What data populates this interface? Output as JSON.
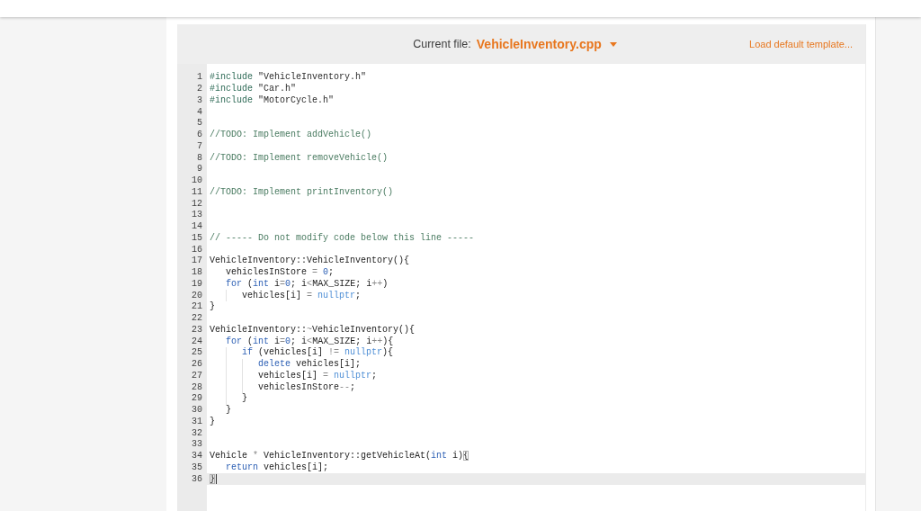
{
  "editor": {
    "current_file_label": "Current file:",
    "current_file": "VehicleInventory.cpp",
    "load_template_link": "Load default template...",
    "lines": [
      {
        "number": "1",
        "active": false,
        "tokens": [
          {
            "kind": "preprocessor",
            "text": "#include "
          },
          {
            "kind": "string",
            "text": "\"VehicleInventory.h\""
          }
        ]
      },
      {
        "number": "2",
        "active": false,
        "tokens": [
          {
            "kind": "preprocessor",
            "text": "#include "
          },
          {
            "kind": "string",
            "text": "\"Car.h\""
          }
        ]
      },
      {
        "number": "3",
        "active": false,
        "tokens": [
          {
            "kind": "preprocessor",
            "text": "#include "
          },
          {
            "kind": "string",
            "text": "\"MotorCycle.h\""
          }
        ]
      },
      {
        "number": "4",
        "active": false
      },
      {
        "number": "5",
        "active": false
      },
      {
        "number": "6",
        "active": false,
        "tokens": [
          {
            "kind": "comment",
            "text": "//TODO: Implement addVehicle()"
          }
        ]
      },
      {
        "number": "7",
        "active": false
      },
      {
        "number": "8",
        "active": false,
        "tokens": [
          {
            "kind": "comment",
            "text": "//TODO: Implement removeVehicle()"
          }
        ]
      },
      {
        "number": "9",
        "active": false
      },
      {
        "number": "10",
        "active": false
      },
      {
        "number": "11",
        "active": false,
        "tokens": [
          {
            "kind": "comment",
            "text": "//TODO: Implement printInventory()"
          }
        ]
      },
      {
        "number": "12",
        "active": false
      },
      {
        "number": "13",
        "active": false
      },
      {
        "number": "14",
        "active": false
      },
      {
        "number": "15",
        "active": false,
        "tokens": [
          {
            "kind": "comment",
            "text": "// ----- Do not modify code below this line -----"
          }
        ]
      },
      {
        "number": "16",
        "active": false
      },
      {
        "number": "17",
        "active": false,
        "tokens": [
          {
            "kind": "plain",
            "text": "VehicleInventory::VehicleInventory(){"
          }
        ]
      },
      {
        "number": "18",
        "active": false,
        "tokens": [
          {
            "kind": "plain",
            "text": "   vehiclesInStore "
          },
          {
            "kind": "operator",
            "text": "="
          },
          {
            "kind": "number",
            "text": " 0"
          },
          {
            "kind": "plain",
            "text": ";"
          }
        ]
      },
      {
        "number": "19",
        "active": false,
        "tokens": [
          {
            "kind": "keyword",
            "text": "   for"
          },
          {
            "kind": "plain",
            "text": " ("
          },
          {
            "kind": "keyword",
            "text": "int"
          },
          {
            "kind": "plain",
            "text": " i"
          },
          {
            "kind": "operator",
            "text": "="
          },
          {
            "kind": "number",
            "text": "0"
          },
          {
            "kind": "plain",
            "text": "; i"
          },
          {
            "kind": "operator",
            "text": "<"
          },
          {
            "kind": "plain",
            "text": "MAX_SIZE; i"
          },
          {
            "kind": "operator",
            "text": "++"
          },
          {
            "kind": "plain",
            "text": ")"
          }
        ]
      },
      {
        "number": "20",
        "active": false,
        "tokens": [
          {
            "kind": "plain",
            "text": "      vehicles[i] "
          },
          {
            "kind": "operator",
            "text": "="
          },
          {
            "kind": "constant",
            "text": " nullptr"
          },
          {
            "kind": "plain",
            "text": ";"
          }
        ]
      },
      {
        "number": "21",
        "active": false,
        "tokens": [
          {
            "kind": "plain",
            "text": "}"
          }
        ]
      },
      {
        "number": "22",
        "active": false
      },
      {
        "number": "23",
        "active": false,
        "tokens": [
          {
            "kind": "plain",
            "text": "VehicleInventory::"
          },
          {
            "kind": "operator",
            "text": "~"
          },
          {
            "kind": "plain",
            "text": "VehicleInventory(){"
          }
        ]
      },
      {
        "number": "24",
        "active": false,
        "tokens": [
          {
            "kind": "keyword",
            "text": "   for"
          },
          {
            "kind": "plain",
            "text": " ("
          },
          {
            "kind": "keyword",
            "text": "int"
          },
          {
            "kind": "plain",
            "text": " i"
          },
          {
            "kind": "operator",
            "text": "="
          },
          {
            "kind": "number",
            "text": "0"
          },
          {
            "kind": "plain",
            "text": "; i"
          },
          {
            "kind": "operator",
            "text": "<"
          },
          {
            "kind": "plain",
            "text": "MAX_SIZE; i"
          },
          {
            "kind": "operator",
            "text": "++"
          },
          {
            "kind": "plain",
            "text": "){"
          }
        ]
      },
      {
        "number": "25",
        "active": false,
        "tokens": [
          {
            "kind": "keyword",
            "text": "      if"
          },
          {
            "kind": "plain",
            "text": " (vehicles[i] "
          },
          {
            "kind": "operator",
            "text": "!="
          },
          {
            "kind": "constant",
            "text": " nullptr"
          },
          {
            "kind": "plain",
            "text": "){"
          }
        ]
      },
      {
        "number": "26",
        "active": false,
        "tokens": [
          {
            "kind": "keyword",
            "text": "         delete"
          },
          {
            "kind": "plain",
            "text": " vehicles[i];"
          }
        ]
      },
      {
        "number": "27",
        "active": false,
        "tokens": [
          {
            "kind": "plain",
            "text": "         vehicles[i] "
          },
          {
            "kind": "operator",
            "text": "="
          },
          {
            "kind": "constant",
            "text": " nullptr"
          },
          {
            "kind": "plain",
            "text": ";"
          }
        ]
      },
      {
        "number": "28",
        "active": false,
        "tokens": [
          {
            "kind": "plain",
            "text": "         vehiclesInStore"
          },
          {
            "kind": "operator",
            "text": "--"
          },
          {
            "kind": "plain",
            "text": ";"
          }
        ]
      },
      {
        "number": "29",
        "active": false,
        "tokens": [
          {
            "kind": "plain",
            "text": "      }"
          }
        ]
      },
      {
        "number": "30",
        "active": false,
        "tokens": [
          {
            "kind": "plain",
            "text": "   }"
          }
        ]
      },
      {
        "number": "31",
        "active": false,
        "tokens": [
          {
            "kind": "plain",
            "text": "}"
          }
        ]
      },
      {
        "number": "32",
        "active": false
      },
      {
        "number": "33",
        "active": false
      },
      {
        "number": "34",
        "active": false,
        "tokens": [
          {
            "kind": "plain",
            "text": "Vehicle "
          },
          {
            "kind": "operator",
            "text": "*"
          },
          {
            "kind": "plain",
            "text": " VehicleInventory::getVehicleAt("
          },
          {
            "kind": "keyword",
            "text": "int"
          },
          {
            "kind": "plain",
            "text": " i)"
          },
          {
            "kind": "matched_bracket",
            "text": "{"
          }
        ]
      },
      {
        "number": "35",
        "active": false,
        "tokens": [
          {
            "kind": "keyword",
            "text": "   return"
          },
          {
            "kind": "plain",
            "text": " vehicles[i];"
          }
        ]
      },
      {
        "number": "36",
        "active": true,
        "tokens": [
          {
            "kind": "matched_bracket",
            "text": "}"
          }
        ]
      }
    ]
  }
}
